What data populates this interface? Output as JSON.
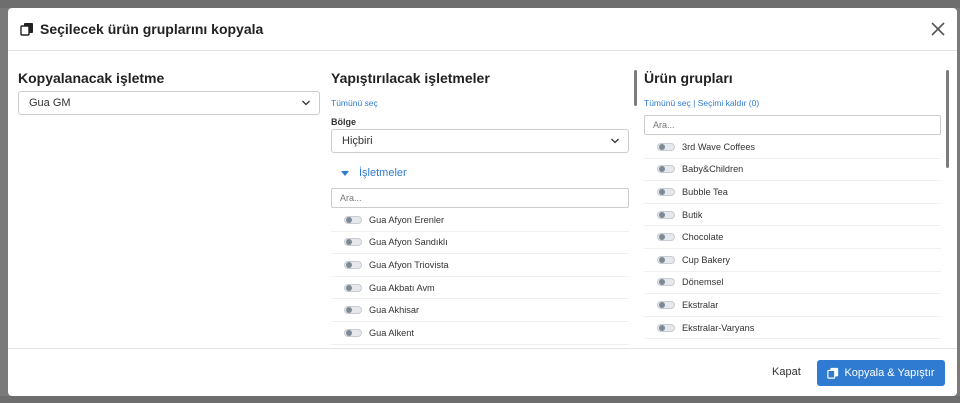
{
  "header": {
    "title": "Seçilecek ürün gruplarını kopyala"
  },
  "source": {
    "label": "Kopyalanacak işletme",
    "selected": "Gua GM"
  },
  "targets": {
    "label": "Yapıştırılacak işletmeler",
    "select_all": "Tümünü seç",
    "region_label": "Bölge",
    "region_selected": "Hiçbiri",
    "group_title": "İşletmeler",
    "search_placeholder": "Ara...",
    "items": [
      {
        "label": "Gua Afyon Erenler"
      },
      {
        "label": "Gua Afyon Sandıklı"
      },
      {
        "label": "Gua Afyon Triovista"
      },
      {
        "label": "Gua Akbatı Avm"
      },
      {
        "label": "Gua Akhisar"
      },
      {
        "label": "Gua Alkent"
      }
    ]
  },
  "groups": {
    "label": "Ürün grupları",
    "select_all": "Tümünü seç",
    "separator": "|",
    "clear_selection": "Seçimi kaldır (0)",
    "search_placeholder": "Ara...",
    "items": [
      {
        "label": "3rd Wave Coffees"
      },
      {
        "label": "Baby&Children"
      },
      {
        "label": "Bubble Tea"
      },
      {
        "label": "Butik"
      },
      {
        "label": "Chocolate"
      },
      {
        "label": "Cup Bakery"
      },
      {
        "label": "Dönemsel"
      },
      {
        "label": "Ekstralar"
      },
      {
        "label": "Ekstralar-Varyans"
      }
    ]
  },
  "footer": {
    "close_label": "Kapat",
    "primary_label": "Kopyala & Yapıştır"
  },
  "colors": {
    "accent": "#2f7bd1",
    "toggle_knob": "#7d8a96"
  }
}
